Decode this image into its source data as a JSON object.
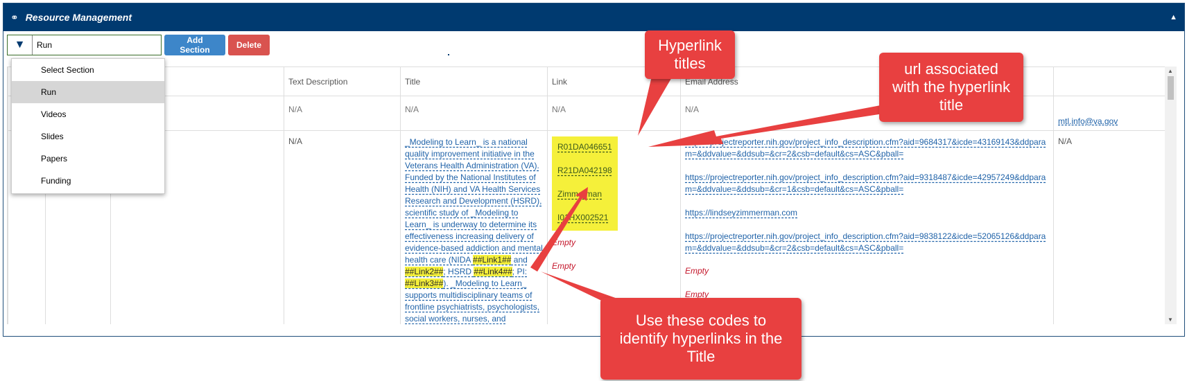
{
  "panel": {
    "title": "Resource Management",
    "link_icon": "⚭",
    "collapse_icon": "▲"
  },
  "toolbar": {
    "selected_section": "Run",
    "add_label": "Add Section",
    "delete_label": "Delete"
  },
  "dropdown": {
    "options": [
      "Select Section",
      "Run",
      "Videos",
      "Slides",
      "Papers",
      "Funding"
    ],
    "selected_index": 1
  },
  "table": {
    "headers": {
      "c1": "",
      "c2": "",
      "c3": "",
      "text_description": "Text Description",
      "title": "Title",
      "link": "Link",
      "email": "Email Address",
      "last": ""
    },
    "row1": {
      "text_description": "N/A",
      "title": "N/A",
      "link": "N/A",
      "email": "N/A",
      "last": "mtl.info@va.gov"
    },
    "row2": {
      "text_description": "N/A",
      "title_a": "_Modeling to Learn_ is a national quality improvement initiative in the Veterans Health Administration (VA). Funded by the National Institutes of Health (NIH) and VA Health Services Research and Development (HSRD), scientific study of _Modeling to Learn_ is underway to determine its effectiveness increasing delivery of evidence-based addiction and mental health care (NIDA ",
      "code1": "##Link1##",
      "title_b": " and ",
      "code2": "##Link2##",
      "title_c": "; HSRD ",
      "code4": "##Link4##",
      "title_d": "; PI: ",
      "code3": "##Link3##",
      "title_e": "). _Modeling to Learn_ supports multidisciplinary teams of frontline psychiatrists, psychologists, social workers, nurses, and pharmacists",
      "links": [
        "R01DA046651",
        "R21DA042198",
        "Zimmerman",
        "I01HX002521"
      ],
      "empty_1": "Empty",
      "empty_2": "Empty",
      "urls": [
        "https://projectreporter.nih.gov/project_info_description.cfm?aid=9684317&icde=43169143&ddparam=&ddvalue=&ddsub=&cr=2&csb=default&cs=ASC&pball=",
        "https://projectreporter.nih.gov/project_info_description.cfm?aid=9318487&icde=42957249&ddparam=&ddvalue=&ddsub=&cr=1&csb=default&cs=ASC&pball=",
        "https://lindseyzimmerman.com",
        "https://projectreporter.nih.gov/project_info_description.cfm?aid=9838122&icde=52065126&ddparam=&ddvalue=&ddsub=&cr=2&csb=default&cs=ASC&pball="
      ],
      "url_empty_1": "Empty",
      "url_empty_2": "Empty",
      "last": "N/A"
    }
  },
  "callouts": {
    "hyperlink_titles": "Hyperlink titles",
    "url_associated": "url associated with the hyperlink title",
    "use_codes": "Use these codes to identify hyperlinks in the Title"
  },
  "colors": {
    "header_bg": "#003a70",
    "add_button": "#3d86c9",
    "delete_button": "#d9534f",
    "callout": "#e84040",
    "highlight": "#f5f03a",
    "link_text": "#1f62a8",
    "empty_text": "#c4162a"
  }
}
